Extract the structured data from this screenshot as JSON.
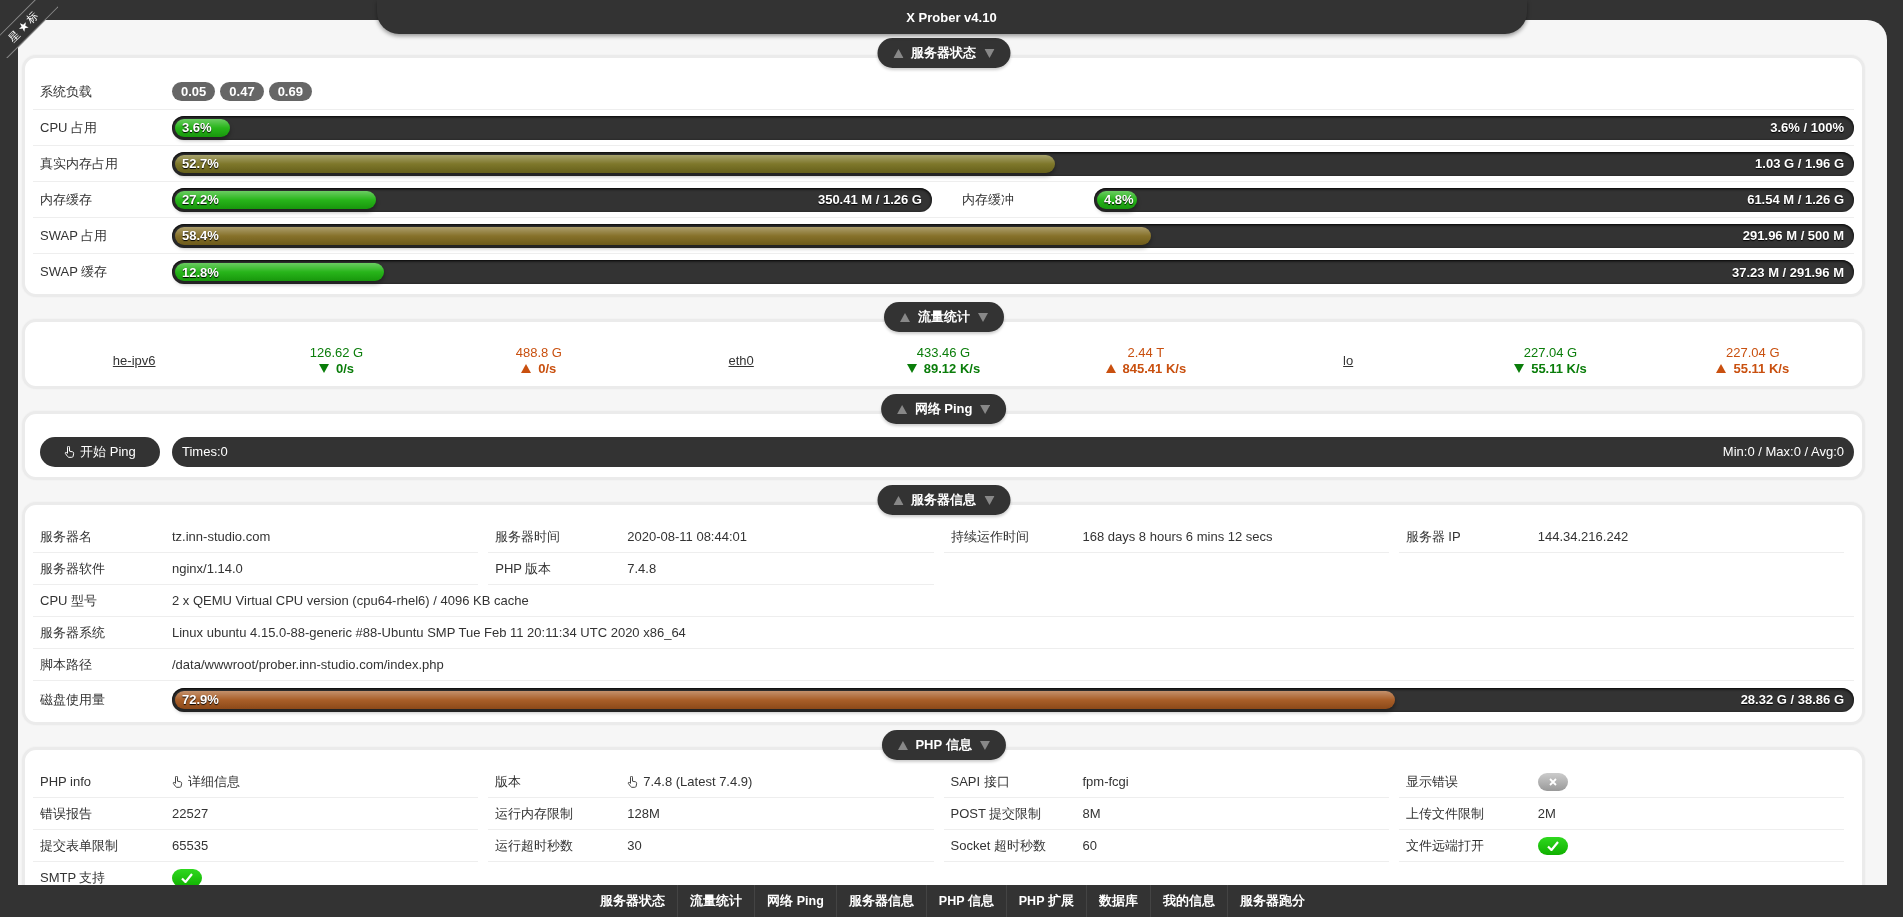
{
  "ribbon": "星★标",
  "title": "X Prober v4.10",
  "server_status": {
    "title": "服务器状态",
    "rows": [
      {
        "kind": "load",
        "label": "系统负载",
        "values": [
          "0.05",
          "0.47",
          "0.69"
        ]
      },
      {
        "kind": "meter",
        "cells": [
          {
            "label": "CPU 占用",
            "percent": "3.6%",
            "reading": "3.6% / 100%",
            "level": 0.036,
            "color": "#1cb10e"
          }
        ]
      },
      {
        "kind": "meter",
        "cells": [
          {
            "label": "真实内存占用",
            "percent": "52.7%",
            "reading": "1.03 G / 1.96 G",
            "level": 0.527,
            "color": "#77701f"
          }
        ]
      },
      {
        "kind": "meter",
        "cells": [
          {
            "label": "内存缓存",
            "percent": "27.2%",
            "reading": "350.41 M / 1.26 G",
            "level": 0.272,
            "color": "#1cb10e"
          },
          {
            "label": "内存缓冲",
            "percent": "4.8%",
            "reading": "61.54 M / 1.26 G",
            "level": 0.048,
            "color": "#1cb10e"
          }
        ]
      },
      {
        "kind": "meter",
        "cells": [
          {
            "label": "SWAP 占用",
            "percent": "58.4%",
            "reading": "291.96 M / 500 M",
            "level": 0.584,
            "color": "#806a1f"
          }
        ]
      },
      {
        "kind": "meter",
        "cells": [
          {
            "label": "SWAP 缓存",
            "percent": "12.8%",
            "reading": "37.23 M / 291.96 M",
            "level": 0.128,
            "color": "#1cb10e"
          }
        ]
      }
    ]
  },
  "traffic": {
    "title": "流量统计",
    "interfaces": [
      {
        "name": "he-ipv6",
        "down_total": "126.62 G",
        "down_rate": "0/s",
        "up_total": "488.8 G",
        "up_rate": "0/s"
      },
      {
        "name": "eth0",
        "down_total": "433.46 G",
        "down_rate": "89.12 K/s",
        "up_total": "2.44 T",
        "up_rate": "845.41 K/s"
      },
      {
        "name": "lo",
        "down_total": "227.04 G",
        "down_rate": "55.11 K/s",
        "up_total": "227.04 G",
        "up_rate": "55.11 K/s"
      }
    ]
  },
  "ping": {
    "title": "网络 Ping",
    "button": "开始 Ping",
    "times": "Times:0",
    "stats": "Min:0 / Max:0 / Avg:0"
  },
  "server_info": {
    "title": "服务器信息",
    "items": [
      {
        "kind": "text",
        "label": "服务器名",
        "value": "tz.inn-studio.com"
      },
      {
        "kind": "text",
        "label": "服务器时间",
        "value": "2020-08-11 08:44:01"
      },
      {
        "kind": "text",
        "label": "持续运作时间",
        "value": "168 days 8 hours 6 mins 12 secs"
      },
      {
        "kind": "text",
        "label": "服务器 IP",
        "value": "144.34.216.242"
      },
      {
        "kind": "text",
        "label": "服务器软件",
        "value": "nginx/1.14.0"
      },
      {
        "kind": "text",
        "label": "PHP 版本",
        "value": "7.4.8"
      },
      {
        "kind": "wide",
        "label": "CPU 型号",
        "value": "2 x QEMU Virtual CPU version (cpu64-rhel6) / 4096 KB cache"
      },
      {
        "kind": "wide",
        "label": "服务器系统",
        "value": "Linux ubuntu 4.15.0-88-generic #88-Ubuntu SMP Tue Feb 11 20:11:34 UTC 2020 x86_64"
      },
      {
        "kind": "wide",
        "label": "脚本路径",
        "value": "/data/wwwroot/prober.inn-studio.com/index.php"
      },
      {
        "kind": "meter",
        "label": "磁盘使用量",
        "percent": "72.9%",
        "reading": "28.32 G / 38.86 G",
        "level": 0.729,
        "color": "#a4561d"
      }
    ]
  },
  "php_info": {
    "title": "PHP 信息",
    "items": [
      {
        "kind": "link",
        "label": "PHP info",
        "value": "详细信息"
      },
      {
        "kind": "link",
        "label": "版本",
        "value": "7.4.8 (Latest 7.4.9)"
      },
      {
        "kind": "text",
        "label": "SAPI 接口",
        "value": "fpm-fcgi"
      },
      {
        "kind": "flag",
        "label": "显示错误",
        "on": false
      },
      {
        "kind": "text",
        "label": "错误报告",
        "value": "22527"
      },
      {
        "kind": "text",
        "label": "运行内存限制",
        "value": "128M"
      },
      {
        "kind": "text",
        "label": "POST 提交限制",
        "value": "8M"
      },
      {
        "kind": "text",
        "label": "上传文件限制",
        "value": "2M"
      },
      {
        "kind": "text",
        "label": "提交表单限制",
        "value": "65535"
      },
      {
        "kind": "text",
        "label": "运行超时秒数",
        "value": "30"
      },
      {
        "kind": "text",
        "label": "Socket 超时秒数",
        "value": "60"
      },
      {
        "kind": "flag",
        "label": "文件远端打开",
        "on": true
      },
      {
        "kind": "flag",
        "label": "SMTP 支持",
        "on": true
      }
    ]
  },
  "footer_nav": [
    "服务器状态",
    "流量统计",
    "网络 Ping",
    "服务器信息",
    "PHP 信息",
    "PHP 扩展",
    "数据库",
    "我的信息",
    "服务器跑分"
  ]
}
